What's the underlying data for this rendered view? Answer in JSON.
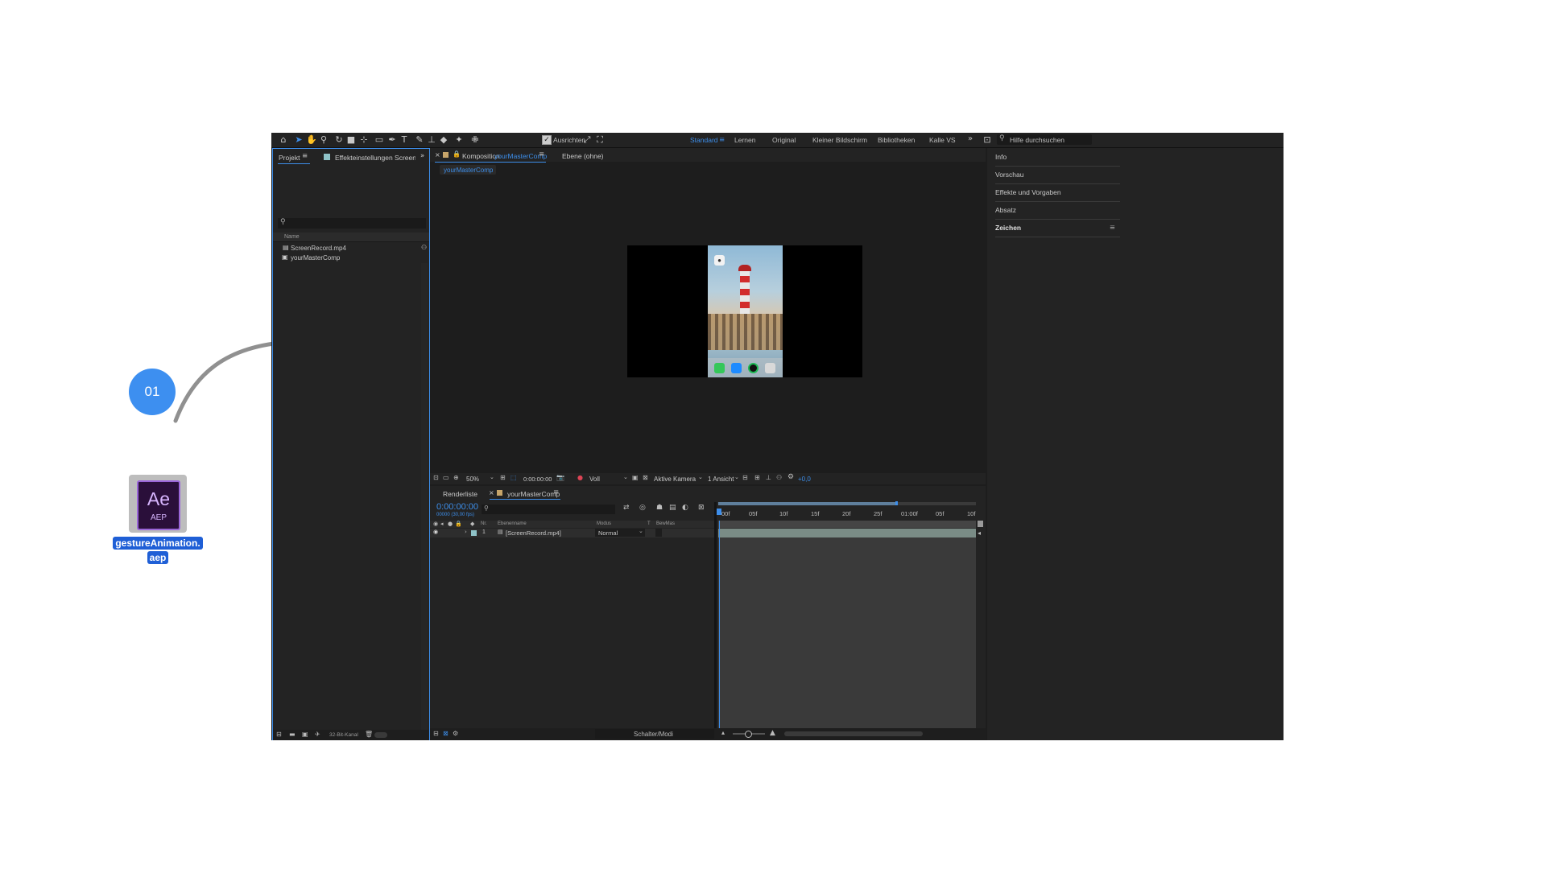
{
  "annotation": {
    "step_number": "01",
    "file_label_line1": "gestureAnimation.",
    "file_label_line2": "aep",
    "file_icon_text": "Ae",
    "file_icon_subtext": "AEP"
  },
  "toolbar": {
    "align_label": "Ausrichten",
    "workspaces": [
      "Standard",
      "Lernen",
      "Original",
      "Kleiner Bildschirm",
      "Bibliotheken",
      "Kalle VS"
    ],
    "active_workspace": "Standard",
    "help_placeholder": "Hilfe durchsuchen"
  },
  "project_panel": {
    "tab_label": "Projekt",
    "effects_tab_label": "Effekteinstellungen ScreenRecord",
    "column_name": "Name",
    "items": [
      {
        "name": "ScreenRecord.mp4",
        "icon": "video-file-icon"
      },
      {
        "name": "yourMasterComp",
        "icon": "composition-icon"
      }
    ],
    "bit_depth": "32-Bit-Kanal"
  },
  "composition_panel": {
    "tab_prefix": "Komposition",
    "tab_comp_name": "yourMasterComp",
    "layer_tab": "Ebene (ohne)",
    "breadcrumb": "yourMasterComp",
    "zoom": "50%",
    "timecode": "0:00:00:00",
    "resolution": "Voll",
    "camera": "Aktive Kamera",
    "views": "1 Ansicht",
    "exposure": "+0,0"
  },
  "timeline": {
    "render_tab": "Renderliste",
    "comp_tab": "yourMasterComp",
    "timecode": "0:00:00:00",
    "fps_text": "00000 (30,00 fps)",
    "columns": {
      "nr": "Nr.",
      "layer_name": "Ebenenname",
      "mode": "Modus",
      "t": "T",
      "trkmat": "BewMas"
    },
    "layers": [
      {
        "nr": "1",
        "name": "[ScreenRecord.mp4]",
        "mode": "Normal"
      }
    ],
    "ruler_labels": [
      "00f",
      "05f",
      "10f",
      "15f",
      "20f",
      "25f",
      "01:00f",
      "05f",
      "10f"
    ],
    "switches_label": "Schalter/Modi"
  },
  "right_panel": {
    "items": [
      "Info",
      "Vorschau",
      "Effekte und Vorgaben",
      "Absatz",
      "Zeichen"
    ]
  },
  "colors": {
    "accent": "#3d8eea",
    "badge": "#3d8ff0",
    "panel_bg": "#232323",
    "app_bg": "#1d1d1d"
  }
}
